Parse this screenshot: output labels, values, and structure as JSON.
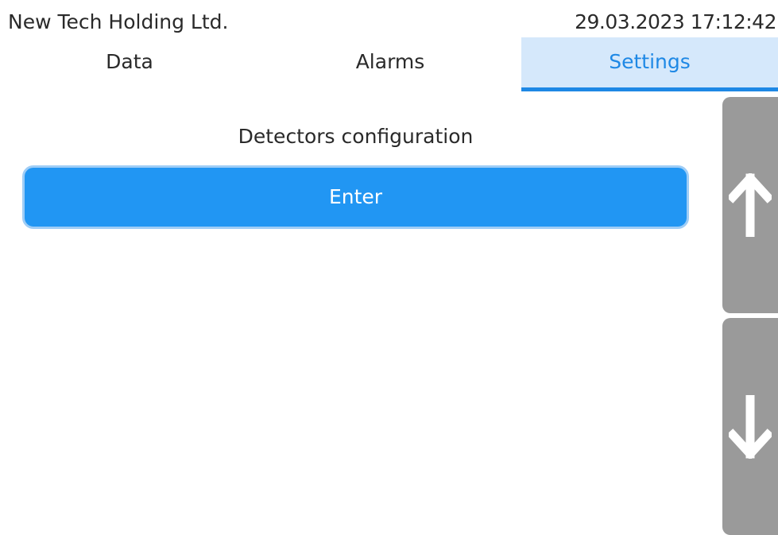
{
  "header": {
    "company": "New Tech Holding Ltd.",
    "datetime": "29.03.2023 17:12:42"
  },
  "tabs": [
    {
      "label": "Data",
      "active": false
    },
    {
      "label": "Alarms",
      "active": false
    },
    {
      "label": "Settings",
      "active": true
    }
  ],
  "main": {
    "section_title": "Detectors configuration",
    "enter_label": "Enter"
  },
  "scroll": {
    "up_icon": "arrow-up-icon",
    "down_icon": "arrow-down-icon"
  },
  "colors": {
    "accent": "#1e88e5",
    "button": "#2196f3",
    "active_tab_bg": "#d5e8fb",
    "scroll_bg": "#9a9a9a"
  }
}
